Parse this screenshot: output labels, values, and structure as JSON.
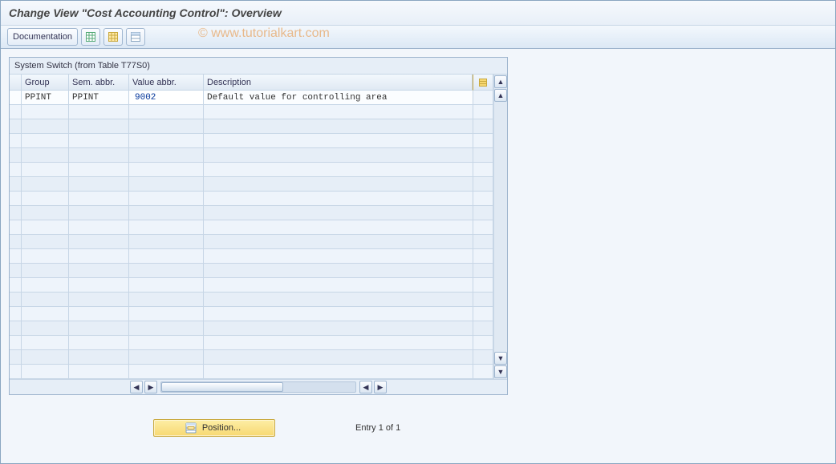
{
  "title": "Change View \"Cost Accounting Control\": Overview",
  "watermark": "© www.tutorialkart.com",
  "toolbar": {
    "documentation_label": "Documentation",
    "icon1": "display-change-icon",
    "icon2": "select-all-icon",
    "icon3": "deselect-all-icon"
  },
  "panel": {
    "title": "System Switch (from Table T77S0)"
  },
  "table": {
    "columns": {
      "group": "Group",
      "sem_abbr": "Sem. abbr.",
      "value_abbr": "Value abbr.",
      "description": "Description"
    },
    "rows": [
      {
        "group": "PPINT",
        "sem_abbr": "PPINT",
        "value_abbr": "9002",
        "description": "Default value for controlling area"
      }
    ],
    "empty_row_count": 19
  },
  "footer": {
    "position_label": "Position...",
    "entry_text": "Entry 1 of 1"
  }
}
